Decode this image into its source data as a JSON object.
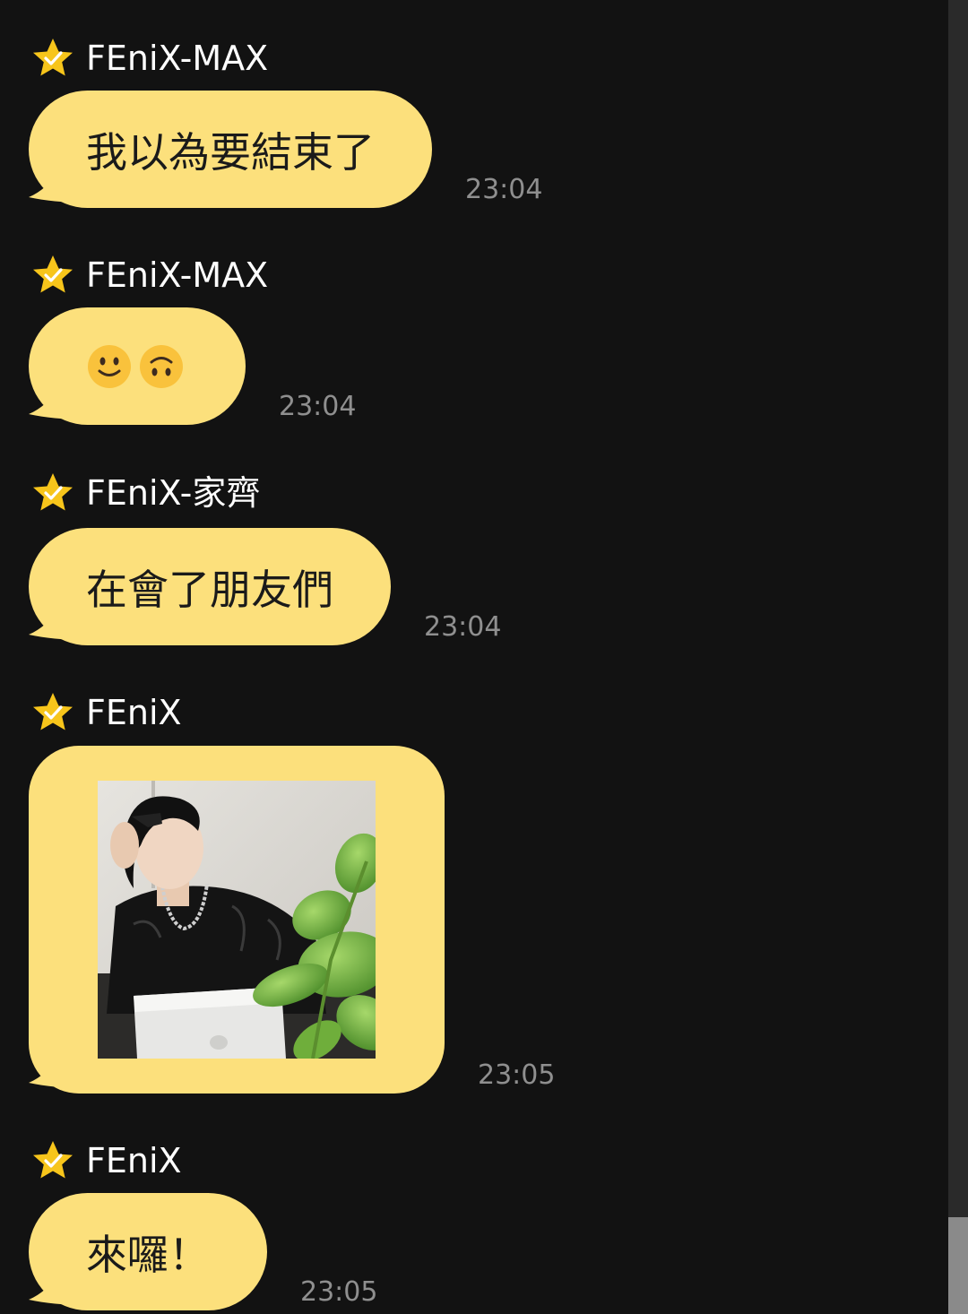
{
  "messages": [
    {
      "sender": "FEniX-MAX",
      "text": "我以為要結束了",
      "time": "23:04"
    },
    {
      "sender": "FEniX-MAX",
      "text": "",
      "emojis": [
        "slightly-smiling-face",
        "upside-down-face"
      ],
      "time": "23:04"
    },
    {
      "sender": "FEniX-家齊",
      "text": "在會了朋友們",
      "time": "23:04"
    },
    {
      "sender": "FEniX",
      "text": "",
      "attachment": "photo",
      "time": "23:05"
    },
    {
      "sender": "FEniX",
      "text": "來囉！",
      "time": "23:05"
    }
  ],
  "colors": {
    "background": "#121212",
    "bubble": "#fce07c",
    "star": "#f7c51b",
    "timestamp": "#8f8f8f",
    "sender": "#ffffff"
  },
  "icons": {
    "sender_badge": "star-check-icon"
  }
}
